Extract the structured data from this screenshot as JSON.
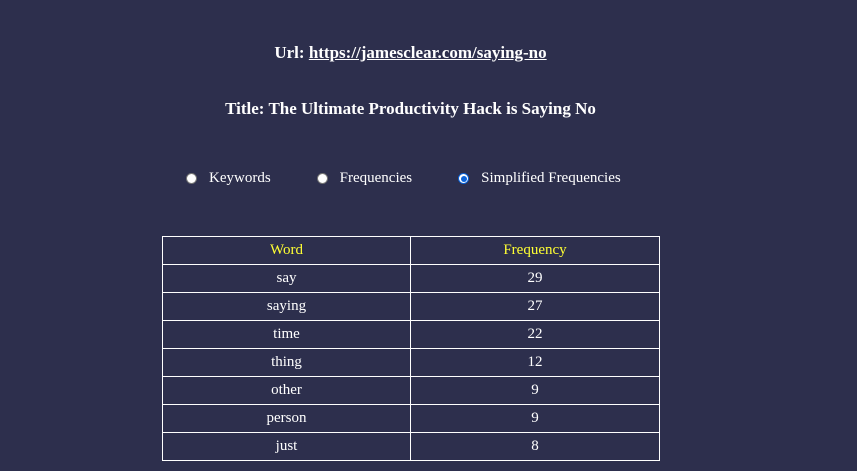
{
  "header": {
    "url_label": "Url:",
    "url": "https://jamesclear.com/saying-no",
    "title_label": "Title:",
    "title": "The Ultimate Productivity Hack is Saying No"
  },
  "view_options": {
    "items": [
      {
        "label": "Keywords",
        "checked": false
      },
      {
        "label": "Frequencies",
        "checked": false
      },
      {
        "label": "Simplified Frequencies",
        "checked": true
      }
    ]
  },
  "table": {
    "headers": [
      "Word",
      "Frequency"
    ],
    "header_color": "#ffff33",
    "rows": [
      {
        "word": "say",
        "frequency": "29"
      },
      {
        "word": "saying",
        "frequency": "27"
      },
      {
        "word": "time",
        "frequency": "22"
      },
      {
        "word": "thing",
        "frequency": "12"
      },
      {
        "word": "other",
        "frequency": "9"
      },
      {
        "word": "person",
        "frequency": "9"
      },
      {
        "word": "just",
        "frequency": "8"
      }
    ]
  },
  "colors": {
    "background": "#2d2f4d",
    "text": "#ffffff",
    "radio_accent": "#0b63d9"
  }
}
